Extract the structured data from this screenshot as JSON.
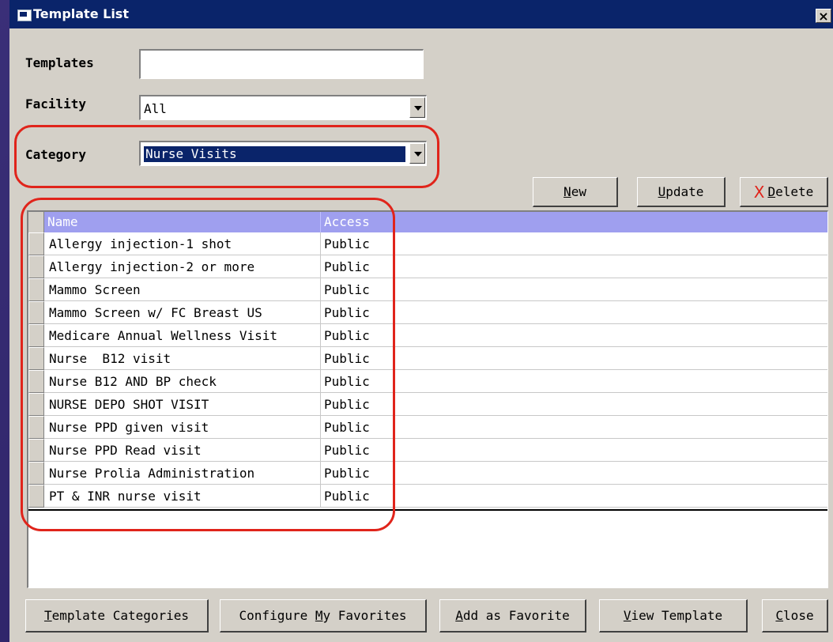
{
  "window": {
    "title": "Template List",
    "close_symbol": "×"
  },
  "form": {
    "templates_label": "Templates",
    "templates_value": "",
    "facility_label": "Facility",
    "facility_value": "All",
    "category_label": "Category",
    "category_value": "Nurse Visits"
  },
  "actions": {
    "new": {
      "ul": "N",
      "rest": "ew"
    },
    "update": {
      "ul": "U",
      "rest": "pdate"
    },
    "delete": {
      "icon": "X",
      "ul": "D",
      "rest": "elete"
    }
  },
  "grid": {
    "columns": [
      "Name",
      "Access"
    ],
    "rows": [
      {
        "name": "Allergy injection-1 shot",
        "access": "Public"
      },
      {
        "name": "Allergy injection-2 or more",
        "access": "Public"
      },
      {
        "name": "Mammo Screen",
        "access": "Public"
      },
      {
        "name": "Mammo Screen w/ FC Breast US",
        "access": "Public"
      },
      {
        "name": "Medicare Annual Wellness Visit",
        "access": "Public"
      },
      {
        "name": "Nurse  B12 visit",
        "access": "Public"
      },
      {
        "name": "Nurse B12 AND BP check",
        "access": "Public"
      },
      {
        "name": "NURSE DEPO SHOT VISIT",
        "access": "Public"
      },
      {
        "name": "Nurse PPD given visit",
        "access": "Public"
      },
      {
        "name": "Nurse PPD Read visit",
        "access": "Public"
      },
      {
        "name": "Nurse Prolia Administration",
        "access": "Public"
      },
      {
        "name": "PT & INR nurse visit",
        "access": "Public"
      }
    ]
  },
  "footer": {
    "template_categories": {
      "ul": "T",
      "rest": "emplate Categories"
    },
    "configure_favorites": {
      "pre": "Configure ",
      "ul": "M",
      "rest": "y Favorites"
    },
    "add_favorite": {
      "ul": "A",
      "rest": "dd as Favorite"
    },
    "view_template": {
      "ul": "V",
      "rest": "iew Template"
    },
    "close": {
      "ul": "C",
      "rest": "lose"
    }
  },
  "colors": {
    "title_bar": "#0a246a",
    "header_row": "#9f9fef",
    "annotation": "#e0241b",
    "delete_icon": "#e0241b"
  }
}
